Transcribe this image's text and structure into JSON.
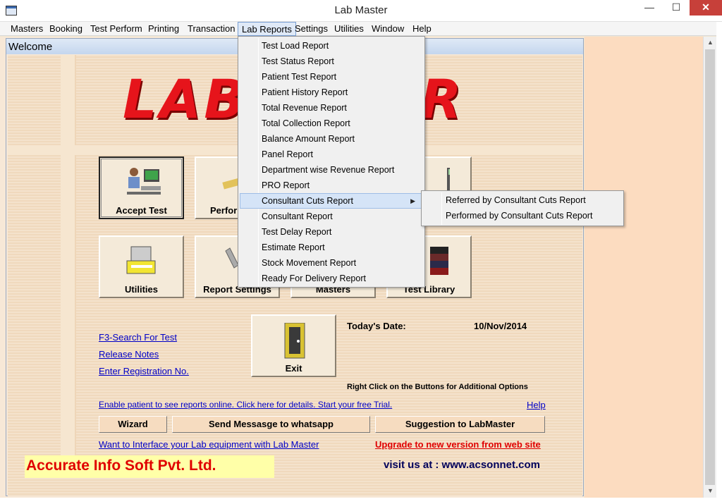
{
  "window": {
    "title": "Lab Master",
    "minimize": "—",
    "maximize": "☐",
    "close": "✕"
  },
  "menubar": [
    {
      "label": "Masters"
    },
    {
      "label": "Booking"
    },
    {
      "label": "Test Perform"
    },
    {
      "label": "Printing"
    },
    {
      "label": "Transaction"
    },
    {
      "label": "Lab Reports"
    },
    {
      "label": "Settings"
    },
    {
      "label": "Utilities"
    },
    {
      "label": "Window"
    },
    {
      "label": "Help"
    }
  ],
  "welcome": {
    "title": "Welcome",
    "logo_part1": "LAB",
    "logo_part2": "R",
    "tiles": {
      "accept_test": "Accept Test",
      "perform": "Perfor",
      "utilities": "Utilities",
      "report_settings": "Report Settings",
      "masters": "Masters",
      "test_library": "Test Library",
      "exit": "Exit"
    },
    "links": {
      "f3_search": "F3-Search For Test",
      "release_notes": "Release Notes",
      "enter_registration": "Enter Registration No.",
      "enable_patient": "Enable patient to see  reports online. Click here for details. Start your free Trial.",
      "help": "Help",
      "interface": "Want to Interface your Lab equipment with Lab Master",
      "upgrade": "Upgrade to new version from web site"
    },
    "todays_date_label": "Today's  Date:",
    "todays_date_value": "10/Nov/2014",
    "right_click_hint": "Right Click on the Buttons for Additional Options",
    "buttons": {
      "wizard": "Wizard",
      "whatsapp": "Send Messasge to whatsapp",
      "suggestion": "Suggestion to LabMaster"
    },
    "company": "Accurate Info Soft Pvt. Ltd.",
    "visit": "visit us at : www.acsonnet.com"
  },
  "lab_reports_menu": {
    "items": [
      "Test Load Report",
      "Test Status Report",
      "Patient Test Report",
      "Patient History Report",
      "Total Revenue Report",
      "Total Collection Report",
      "Balance Amount Report",
      "Panel Report",
      "Department wise  Revenue Report",
      "PRO Report",
      "Consultant Cuts Report",
      "Consultant Report",
      "Test Delay Report",
      "Estimate Report",
      "Stock Movement Report",
      "Ready For Delivery Report"
    ],
    "submenu_arrow": "▶"
  },
  "consultant_cuts_submenu": {
    "items": [
      "Referred by Consultant Cuts Report",
      "Performed by Consultant Cuts Report"
    ]
  },
  "scrollbar": {
    "up": "▲",
    "down": "▼"
  }
}
